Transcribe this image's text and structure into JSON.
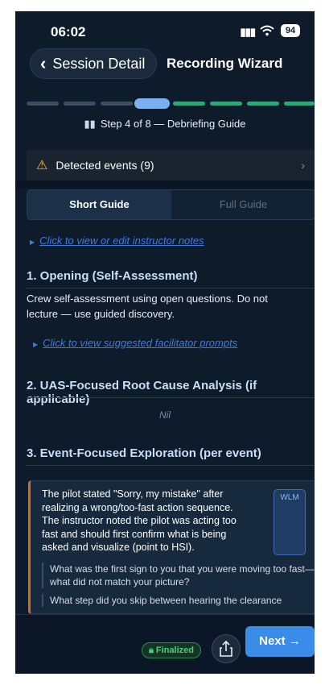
{
  "status_bar": {
    "time": "06:02",
    "battery": "94"
  },
  "nav": {
    "back_label": "Session Detail",
    "title": "Recording Wizard"
  },
  "progress": {
    "total_steps": 8,
    "current_step": 4,
    "label": "Step 4 of 8 — Debriefing Guide"
  },
  "events": {
    "label": "Detected events (9)"
  },
  "tabs": [
    {
      "label": "Short Guide",
      "active": true
    },
    {
      "label": "Full Guide",
      "active": false
    }
  ],
  "instructor_notes_link": "Click to view or edit instructor notes",
  "sections": [
    {
      "title": "1. Opening (Self-Assessment)",
      "body": "Crew self-assessment using open questions. Do not lecture — use guided discovery.",
      "link": "Click to view suggested facilitator prompts"
    },
    {
      "title": "2. UAS-Focused Root Cause Analysis (if applicable)",
      "body": "Nil"
    },
    {
      "title": "3. Event-Focused Exploration (per event)"
    }
  ],
  "event_card": {
    "text": "The pilot stated \"Sorry, my mistake\" after realizing a wrong/too-fast action sequence. The instructor noted the pilot was acting too fast and should first confirm what is being asked and visualize (point to HSI).",
    "tag": "WLM",
    "questions": [
      "What was the first sign to you that you were moving too fast—what did not match your picture?",
      "What step did you skip between hearing the clearance"
    ]
  },
  "footer": {
    "status_badge": "Finalized",
    "next_label": "Next →"
  },
  "colors": {
    "background": "#0e1b2b",
    "accent": "#3b8ce8",
    "progress_done": "#2fa679",
    "progress_current": "#7aaff0",
    "warning": "#f4c22b",
    "link": "#3d7be0",
    "event_border": "#d06a2c"
  }
}
